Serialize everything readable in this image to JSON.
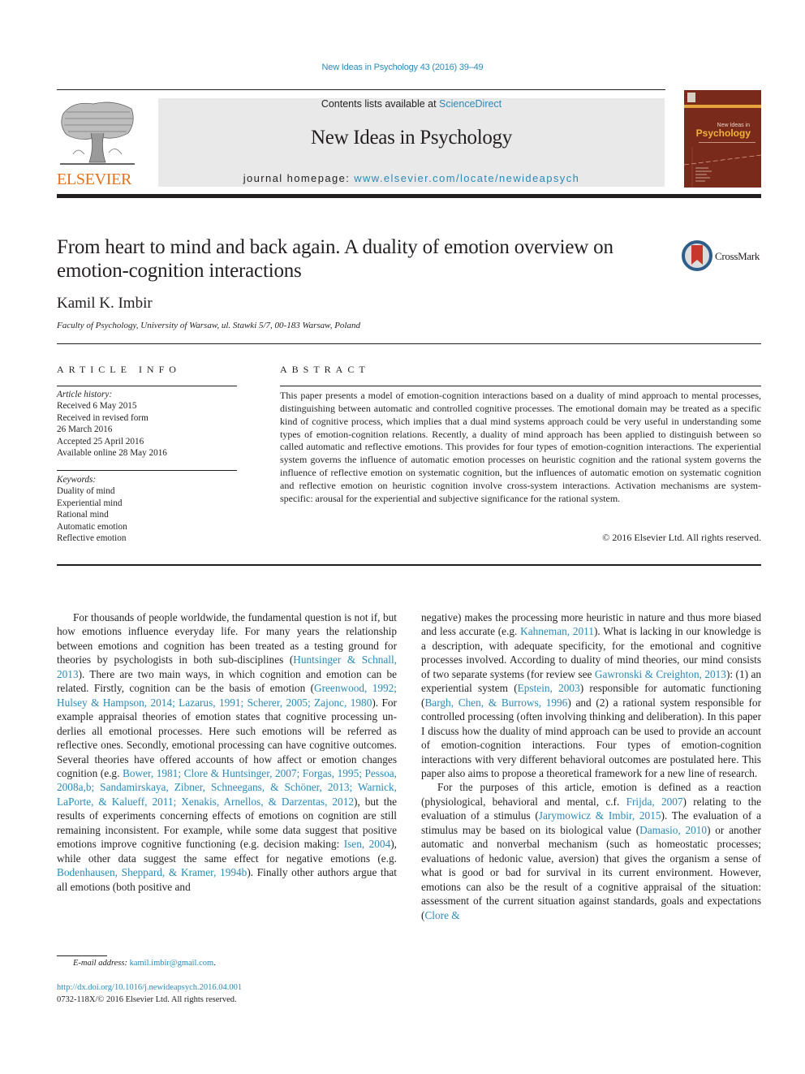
{
  "header": {
    "journal_ref": "New Ideas in Psychology 43 (2016) 39–49",
    "contents_prefix": "Contents lists available at ",
    "contents_link": "ScienceDirect",
    "journal_name": "New Ideas in Psychology",
    "homepage_prefix": "journal homepage: ",
    "homepage_link": "www.elsevier.com/locate/newideapsych",
    "publisher_logo_text": "ELSEVIER",
    "cover": {
      "subtitle": "New Ideas in",
      "title": "Psychology"
    },
    "colors": {
      "link": "#2a8ab8",
      "elsevier_orange": "#e9711c",
      "cover_bg": "#7a2a1a",
      "cover_title": "#f1b23d",
      "banner_bg": "#e9e9e9"
    }
  },
  "article": {
    "title": "From heart to mind and back again. A duality of emotion overview on emotion-cognition interactions",
    "crossmark_label": "CrossMark",
    "author": "Kamil K. Imbir",
    "affiliation": "Faculty of Psychology, University of Warsaw, ul. Stawki 5/7, 00-183 Warsaw, Poland"
  },
  "article_info": {
    "heading": "ARTICLE INFO",
    "history_label": "Article history:",
    "history": [
      "Received 6 May 2015",
      "Received in revised form",
      "26 March 2016",
      "Accepted 25 April 2016",
      "Available online 28 May 2016"
    ],
    "keywords_label": "Keywords:",
    "keywords": [
      "Duality of mind",
      "Experiential mind",
      "Rational mind",
      "Automatic emotion",
      "Reflective emotion"
    ]
  },
  "abstract": {
    "heading": "ABSTRACT",
    "text": "This paper presents a model of emotion-cognition interactions based on a duality of mind approach to mental processes, distinguishing between automatic and controlled cognitive processes. The emotional domain may be treated as a specific kind of cognitive process, which implies that a dual mind systems approach could be very useful in understanding some types of emotion-cognition relations. Recently, a duality of mind approach has been applied to distinguish between so called automatic and reflective emotions. This provides for four types of emotion-cognition interactions. The experiential system gov­erns the influence of automatic emotion processes on heuristic cognition and the rational system governs the influence of reflective emotion on systematic cognition, but the influences of automatic emotion on systematic cognition and reflective emotion on heuristic cognition involve cross-system interactions. Activation mechanisms are system-specific: arousal for the experiential and subjective significance for the rational system.",
    "copyright": "© 2016 Elsevier Ltd. All rights reserved."
  },
  "body": {
    "left": {
      "p1": [
        {
          "t": "For thousands of people worldwide, the fundamental question is not if, but how emotions influence everyday life. For many years the relationship between emotions and cognition has been treated as a testing ground for theories by psychologists in both sub-disciplines ("
        },
        {
          "l": "Huntsinger & Schnall, 2013"
        },
        {
          "t": "). There are two main ways, in which cognition and emotion can be related. Firstly, cognition can be the basis of emotion ("
        },
        {
          "l": "Greenwood, 1992; Hulsey & Hampson, 2014; Lazarus, 1991; Scherer, 2005; Zajonc, 1980"
        },
        {
          "t": "). For example appraisal theories of emotion states that cognitive processing un­derlies all emotional processes. Here such emotions will be referred as reflective ones. Secondly, emotional processing can have cogni­tive outcomes. Several theories have offered accounts of how affect or emotion changes cognition (e.g. "
        },
        {
          "l": "Bower, 1981; Clore & Huntsinger, 2007; Forgas, 1995; Pessoa, 2008a,b; Sandamirskaya, Zibner, Schneegans, & Schöner, 2013; Warnick, LaPorte, & Kalueff, 2011; Xenakis, Arnellos, & Darzentas, 2012"
        },
        {
          "t": "), but the results of ex­periments concerning effects of emotions on cognition are still remaining inconsistent. For example, while some data suggest that positive emotions improve cognitive functioning (e.g. decision making: "
        },
        {
          "l": "Isen, 2004"
        },
        {
          "t": "), while other data suggest the same effect for negative emotions (e.g. "
        },
        {
          "l": "Bodenhausen, Sheppard, & Kramer, 1994b"
        },
        {
          "t": "). Finally other authors argue that all emotions (both positive and"
        }
      ]
    },
    "right": {
      "p1": [
        {
          "t": "negative) makes the processing more heuristic in nature and thus more biased and less accurate (e.g. "
        },
        {
          "l": "Kahneman, 2011"
        },
        {
          "t": "). What is lacking in our knowledge is a description, with adequate specificity, for the emotional and cognitive processes involved. According to duality of mind theories, our mind consists of two separate systems (for review see "
        },
        {
          "l": "Gawronski & Creighton, 2013"
        },
        {
          "t": "): (1) an experiential system ("
        },
        {
          "l": "Epstein, 2003"
        },
        {
          "t": ") responsible for automatic functioning ("
        },
        {
          "l": "Bargh, Chen, & Burrows, 1996"
        },
        {
          "t": ") and (2) a rational system respon­sible for controlled processing (often involving thinking and deliberation). In this paper I discuss how the duality of mind approach can be used to provide an account of emotion-cognition interactions. Four types of emotion-cognition interactions with very different behavioral outcomes are postulated here. This paper also aims to propose a theoretical framework for a new line of research."
        }
      ],
      "p2": [
        {
          "t": "For the purposes of this article, emotion is defined as a reaction (physiological, behavioral and mental, c.f. "
        },
        {
          "l": "Frijda, 2007"
        },
        {
          "t": ") relating to the evaluation of a stimulus ("
        },
        {
          "l": "Jarymowicz & Imbir, 2015"
        },
        {
          "t": "). The evaluation of a stimulus may be based on its biological value ("
        },
        {
          "l": "Damasio, 2010"
        },
        {
          "t": ") or another automatic and nonverbal mechanism (such as homeostatic processes; evaluations of hedonic value, aversion) that gives the organism a sense of what is good or bad for survival in its current environment. However, emotions can also be the result of a cognitive appraisal of the situation: assessment of the current situation against standards, goals and expectations ("
        },
        {
          "l": "Clore &"
        }
      ]
    }
  },
  "footer": {
    "email_label": "E-mail address:",
    "email": "kamil.imbir@gmail.com",
    "email_suffix": ".",
    "doi": "http://dx.doi.org/10.1016/j.newideapsych.2016.04.001",
    "issn": "0732-118X/© 2016 Elsevier Ltd. All rights reserved."
  }
}
